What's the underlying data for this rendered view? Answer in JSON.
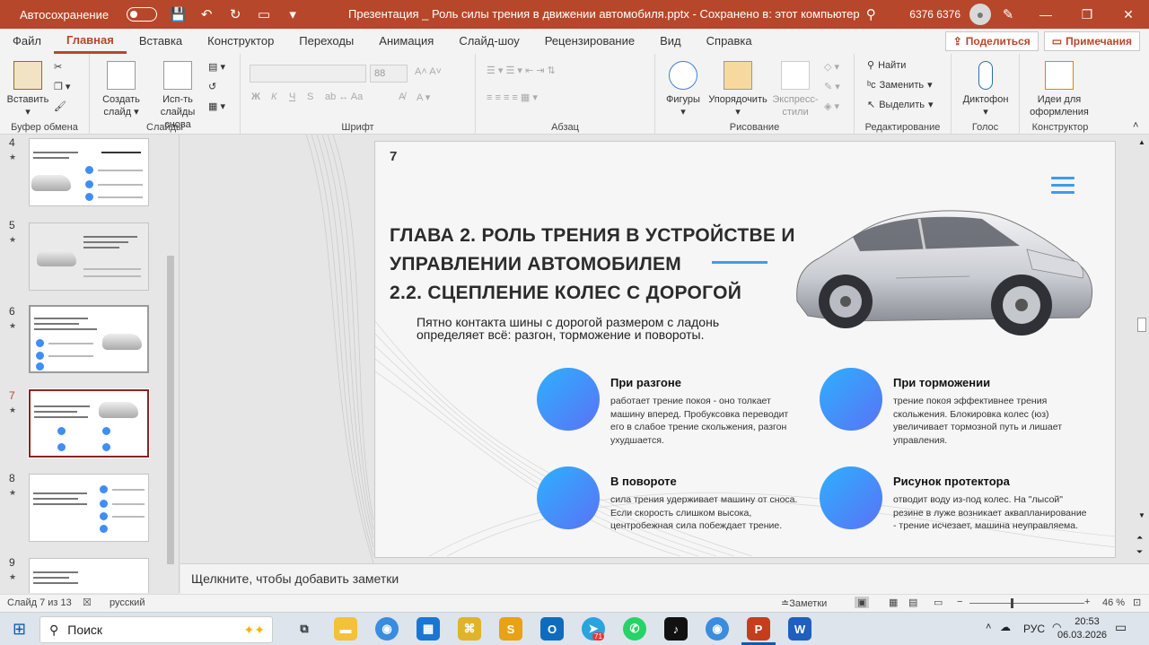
{
  "title_bar": {
    "autosave_label": "Автосохранение",
    "doc_title": "Презентация _ Роль силы трения в движении автомобиля.pptx  -  Сохранено в: этот компьютер",
    "user_name": "6376 6376",
    "undo_icon": "↶",
    "redo_icon": "↻",
    "save_icon": "💾",
    "search_icon": "⚲",
    "minimize": "—",
    "restore": "❐",
    "close": "✕"
  },
  "menu": {
    "tabs": [
      "Файл",
      "Главная",
      "Вставка",
      "Конструктор",
      "Переходы",
      "Анимация",
      "Слайд-шоу",
      "Рецензирование",
      "Вид",
      "Справка"
    ],
    "share_label": "Поделиться",
    "comments_label": "Примечания"
  },
  "ribbon": {
    "clipboard": {
      "paste": "Вставить",
      "group": "Буфер обмена"
    },
    "slides": {
      "new_slide": "Создать слайд",
      "reuse": "Исп-ть слайды снова",
      "group": "Слайды"
    },
    "font": {
      "size": "88",
      "bold": "Ж",
      "italic": "К",
      "underline": "Ч",
      "strike": "S",
      "group": "Шрифт"
    },
    "paragraph": {
      "group": "Абзац"
    },
    "drawing": {
      "shapes": "Фигуры",
      "arrange": "Упорядочить",
      "styles": "Экспресс-стили",
      "group": "Рисование"
    },
    "editing": {
      "find": "Найти",
      "replace": "Заменить",
      "select": "Выделить",
      "group": "Редактирование"
    },
    "voice": {
      "dictate": "Диктофон",
      "group": "Голос"
    },
    "designer": {
      "ideas": "Идеи для оформления",
      "group": "Конструктор"
    }
  },
  "thumbnails": [
    {
      "num": "4",
      "star": "★",
      "title": "ГЛАВА 1. ТЕОРЕТИЧЕСКИЕ ОСНОВЫ 1.1 ПОНЯТИЕ И ВИДЫ СИЛЫ ТРЕНИЯ"
    },
    {
      "num": "5",
      "star": "★",
      "title": "ГЛАВА 1. ТЕОРЕТИЧЕСКИЕ ОСНОВЫ 1.2 ФИЗИЧЕСКАЯ ПРИРОДА И ФАКТОРЫ ТРЕНИЯ"
    },
    {
      "num": "6",
      "star": "★",
      "title": "ГЛАВА 2. РОЛЬ ТРЕНИЯ В УСТРОЙСТВЕ И УПРАВЛЕНИИ АВТОМОБИЛЕМ 2.1 СИЛА ТРЕНИЯ В РАБОТЕ УЗЛОВ АВТОМОБИЛЯ"
    },
    {
      "num": "7",
      "star": "★",
      "title": "ГЛАВА 2. РОЛЬ ТРЕНИЯ В УСТРОЙСТВЕ И УПРАВЛЕНИИ АВТОМОБИЛЕМ 2.2. СЦЕПЛЕНИЕ КОЛЕС С ДОРОГОЙ"
    },
    {
      "num": "8",
      "star": "★",
      "title": "ГЛАВА 2. РОЛЬ ТРЕНИЯ В УСТРОЙСТВЕ И УПРАВЛЕНИИ АВТОМОБИЛЕМ"
    },
    {
      "num": "9",
      "star": "★",
      "title": "ГЛАВА 3. ПРАКТИЧЕСКОЕ ИССЛЕДОВАНИЕ 3.1 МЕТОДИКА ПРОВЕДЕНИЯ ЭКСПЕРИМЕНТА"
    }
  ],
  "slide": {
    "number": "7",
    "title_line1": "ГЛАВА 2. РОЛЬ ТРЕНИЯ В УСТРОЙСТВЕ И",
    "title_line2": "УПРАВЛЕНИИ АВТОМОБИЛЕМ",
    "title_line3": "2.2. СЦЕПЛЕНИЕ КОЛЕС С ДОРОГОЙ",
    "intro": "Пятно контакта шины с дорогой размером с ладонь определяет всё: разгон, торможение и повороты.",
    "items": [
      {
        "title": "При разгоне",
        "text": "работает трение покоя - оно толкает машину вперед. Пробуксовка переводит его в слабое трение скольжения, разгон ухудшается."
      },
      {
        "title": "При торможении",
        "text": "трение покоя эффективнее трения скольжения. Блокировка колес (юз) увеличивает тормозной путь и лишает управления."
      },
      {
        "title": "В повороте",
        "text": "сила трения удерживает машину от сноса. Если скорость слишком высока, центробежная сила побеждает трение."
      },
      {
        "title": "Рисунок протектора",
        "text": "отводит воду из-под колес. На \"лысой\" резине в луже возникает аквапланирование - трение исчезает, машина неуправляема."
      }
    ],
    "accent_color": "#3d9bf0"
  },
  "notes_placeholder": "Щелкните, чтобы добавить заметки",
  "status_bar": {
    "slide_info": "Слайд 7 из 13",
    "language": "русский",
    "notes_btn": "Заметки",
    "zoom": "46 %"
  },
  "taskbar": {
    "search": "Поиск",
    "lang": "РУС",
    "time": "20:53",
    "date": "06.03.2026",
    "telegram_badge": "71"
  }
}
